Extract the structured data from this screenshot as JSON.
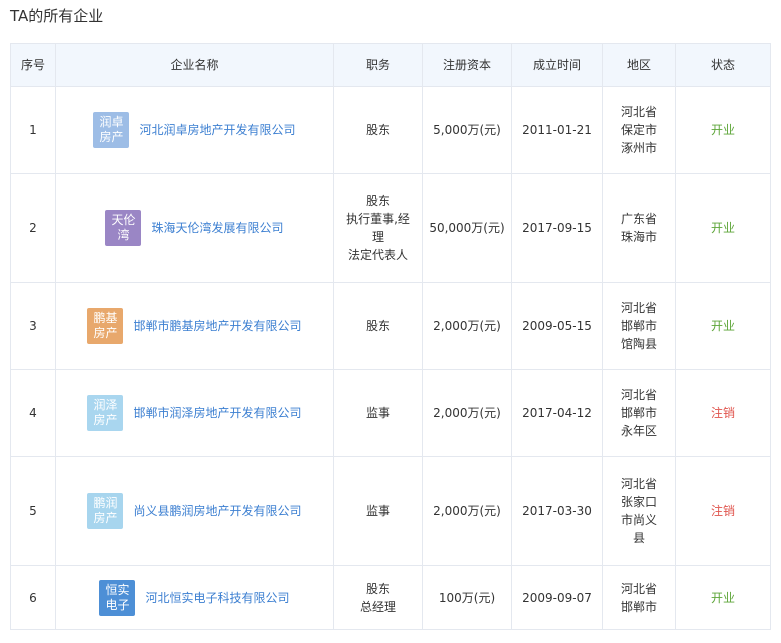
{
  "section": {
    "title": "TA的所有企业"
  },
  "table": {
    "headers": {
      "index": "序号",
      "name": "企业名称",
      "role": "职务",
      "capital": "注册资本",
      "date": "成立时间",
      "region": "地区",
      "status": "状态"
    },
    "rows": [
      {
        "index": "1",
        "logo": {
          "line1": "润卓",
          "line2": "房产",
          "color": "#9dbde6"
        },
        "name": "河北润卓房地产开发有限公司",
        "roles": [
          "股东"
        ],
        "capital": "5,000万(元)",
        "date": "2011-01-21",
        "region": [
          "河北省",
          "保定市",
          "涿州市"
        ],
        "status": "开业"
      },
      {
        "index": "2",
        "logo": {
          "line1": "天伦",
          "line2": "湾",
          "color": "#9a86c5"
        },
        "name": "珠海天伦湾发展有限公司",
        "roles": [
          "股东",
          "执行董事,经",
          "理",
          "法定代表人"
        ],
        "capital": "50,000万(元)",
        "date": "2017-09-15",
        "region": [
          "广东省",
          "珠海市"
        ],
        "status": "开业"
      },
      {
        "index": "3",
        "logo": {
          "line1": "鹏基",
          "line2": "房产",
          "color": "#e8a86c"
        },
        "name": "邯郸市鹏基房地产开发有限公司",
        "roles": [
          "股东"
        ],
        "capital": "2,000万(元)",
        "date": "2009-05-15",
        "region": [
          "河北省",
          "邯郸市",
          "馆陶县"
        ],
        "status": "开业"
      },
      {
        "index": "4",
        "logo": {
          "line1": "润泽",
          "line2": "房产",
          "color": "#a9d6ef"
        },
        "name": "邯郸市润泽房地产开发有限公司",
        "roles": [
          "监事"
        ],
        "capital": "2,000万(元)",
        "date": "2017-04-12",
        "region": [
          "河北省",
          "邯郸市",
          "永年区"
        ],
        "status": "注销"
      },
      {
        "index": "5",
        "logo": {
          "line1": "鹏润",
          "line2": "房产",
          "color": "#a7d5ee"
        },
        "name": "尚义县鹏润房地产开发有限公司",
        "roles": [
          "监事"
        ],
        "capital": "2,000万(元)",
        "date": "2017-03-30",
        "region": [
          "河北省",
          "张家口",
          "市尚义",
          "县"
        ],
        "status": "注销"
      },
      {
        "index": "6",
        "logo": {
          "line1": "恒实",
          "line2": "电子",
          "color": "#4d8fd6"
        },
        "name": "河北恒实电子科技有限公司",
        "roles": [
          "股东",
          "总经理"
        ],
        "capital": "100万(元)",
        "date": "2009-09-07",
        "region": [
          "河北省",
          "邯郸市"
        ],
        "status": "开业"
      }
    ]
  },
  "colors": {
    "link": "#3c7fd1",
    "status_open": "#5ea63a",
    "status_closed": "#e0544d",
    "header_bg": "#f2f7fd",
    "border": "#e4e8ef"
  }
}
